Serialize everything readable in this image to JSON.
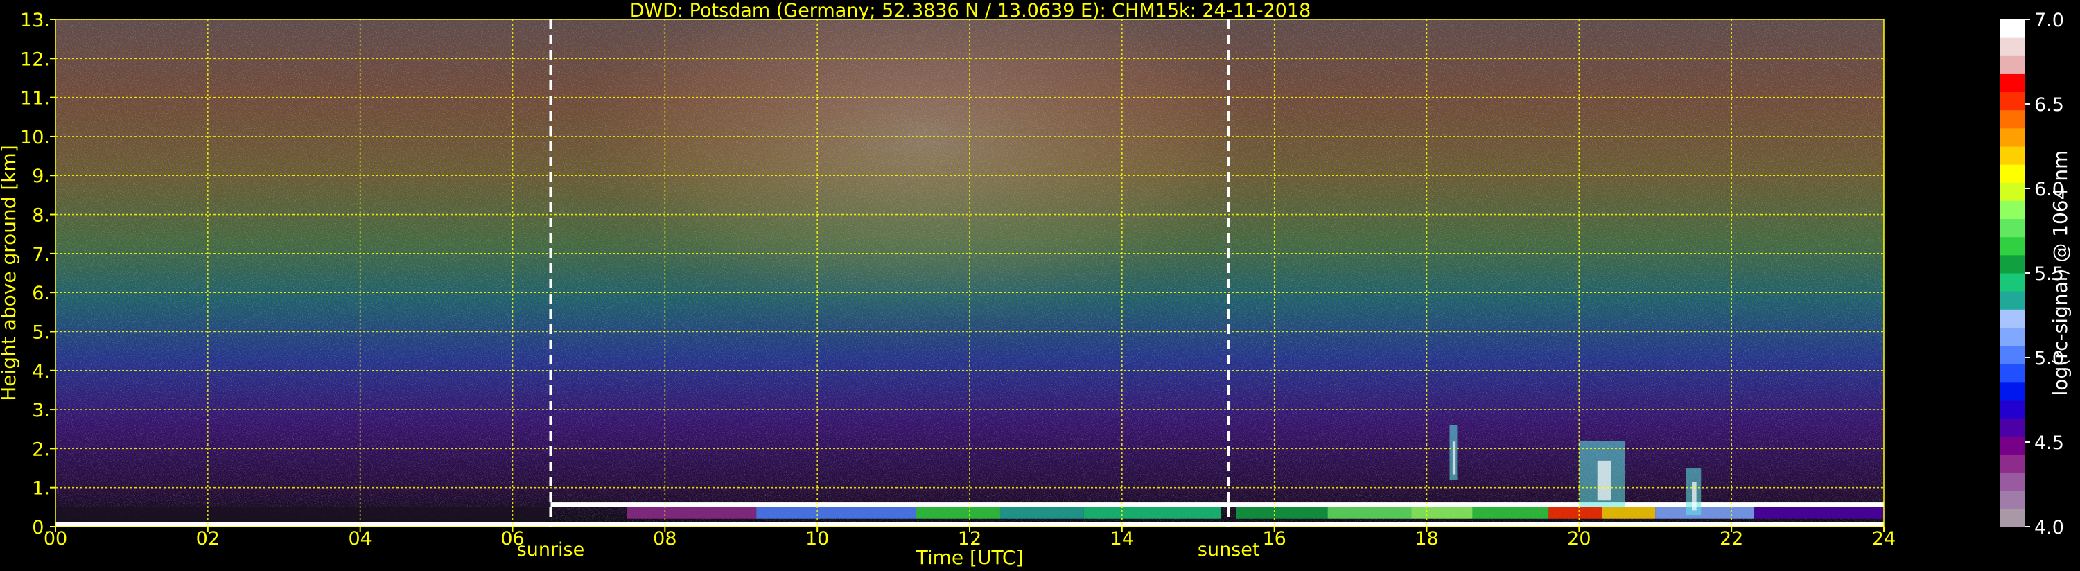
{
  "chart_data": {
    "type": "heatmap",
    "title": "DWD: Potsdam (Germany; 52.3836 N / 13.0639 E):    CHM15k: 24-11-2018",
    "xlabel": "Time [UTC]",
    "ylabel": "Height above ground [km]",
    "xlim": [
      0,
      24
    ],
    "ylim": [
      0,
      13
    ],
    "x_ticks": [
      "00",
      "02",
      "04",
      "06",
      "08",
      "10",
      "12",
      "14",
      "16",
      "18",
      "20",
      "22",
      "24"
    ],
    "y_ticks": [
      "0.",
      "1.",
      "2.",
      "3.",
      "4.",
      "5.",
      "6.",
      "7.",
      "8.",
      "9.",
      "10.",
      "11.",
      "12.",
      "13."
    ],
    "grid": true,
    "events": [
      {
        "label": "sunrise",
        "time": 6.5
      },
      {
        "label": "sunset",
        "time": 15.4
      }
    ],
    "colorbar": {
      "label": "log(rc-signal) @ 1064 nm",
      "range": [
        4.0,
        7.0
      ],
      "ticks": [
        "4.0",
        "4.5",
        "5.0",
        "5.5",
        "6.0",
        "6.5",
        "7.0"
      ],
      "colors": [
        "#a898a8",
        "#a07ca8",
        "#9a5aa0",
        "#8e2c8c",
        "#780088",
        "#4c00a8",
        "#2200d0",
        "#0018f0",
        "#2050ff",
        "#5080ff",
        "#80a8ff",
        "#a8c4ff",
        "#20a898",
        "#18c878",
        "#10a040",
        "#30d040",
        "#60e860",
        "#90ff60",
        "#d0ff20",
        "#ffff00",
        "#ffd000",
        "#ffa000",
        "#ff7000",
        "#ff3000",
        "#ff0000",
        "#e8b0b0",
        "#f0d8d8",
        "#ffffff"
      ]
    },
    "features": [
      {
        "name": "boundary layer / low cloud top",
        "time_range": [
          6.5,
          24
        ],
        "height_km": [
          0.3,
          0.7
        ]
      },
      {
        "name": "cloud plume",
        "time_range": [
          18.3,
          18.4
        ],
        "height_km": [
          1.2,
          2.6
        ]
      },
      {
        "name": "cloud plumes",
        "time_range": [
          20.0,
          20.6
        ],
        "height_km": [
          0.5,
          2.2
        ]
      },
      {
        "name": "cloud plume",
        "time_range": [
          21.4,
          21.6
        ],
        "height_km": [
          0.3,
          1.5
        ]
      }
    ]
  },
  "colors": {
    "background": "#000000",
    "axis_text": "#ffff00",
    "grid": "#ffff00",
    "event_line": "#ffffff"
  }
}
